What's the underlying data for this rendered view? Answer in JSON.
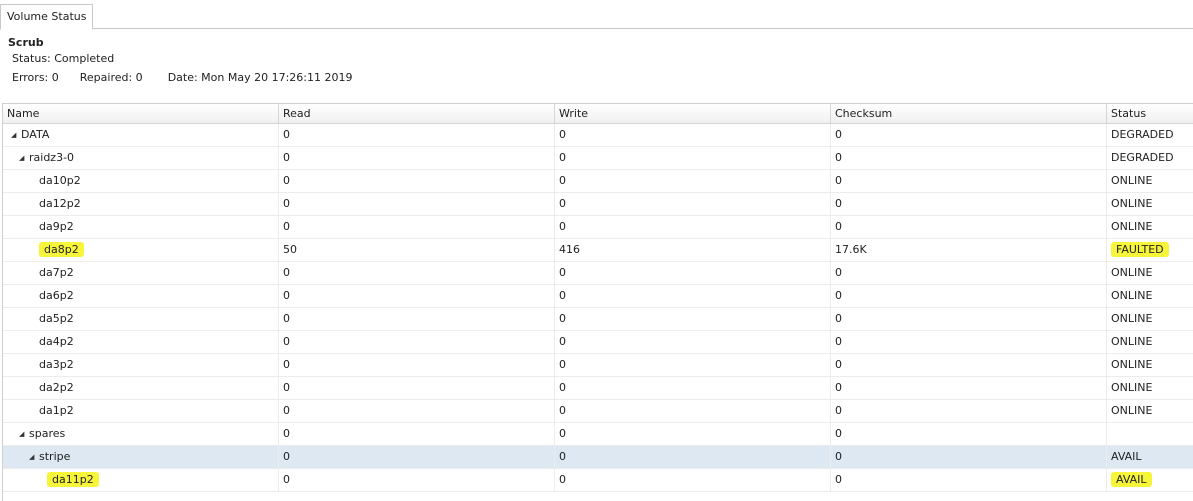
{
  "tab": {
    "label": "Volume Status"
  },
  "scrub": {
    "title": "Scrub",
    "status": "Status: Completed",
    "errors": "Errors: 0",
    "repaired": "Repaired: 0",
    "date": "Date: Mon May 20 17:26:11 2019"
  },
  "columns": [
    "Name",
    "Read",
    "Write",
    "Checksum",
    "Status"
  ],
  "rows": [
    {
      "name": "DATA",
      "read": "0",
      "write": "0",
      "checksum": "0",
      "status": "DEGRADED",
      "depth": 0,
      "expander": true
    },
    {
      "name": "raidz3-0",
      "read": "0",
      "write": "0",
      "checksum": "0",
      "status": "DEGRADED",
      "depth": 1,
      "expander": true
    },
    {
      "name": "da10p2",
      "read": "0",
      "write": "0",
      "checksum": "0",
      "status": "ONLINE",
      "depth": 2,
      "expander": false
    },
    {
      "name": "da12p2",
      "read": "0",
      "write": "0",
      "checksum": "0",
      "status": "ONLINE",
      "depth": 2,
      "expander": false
    },
    {
      "name": "da9p2",
      "read": "0",
      "write": "0",
      "checksum": "0",
      "status": "ONLINE",
      "depth": 2,
      "expander": false
    },
    {
      "name": "da8p2",
      "read": "50",
      "write": "416",
      "checksum": "17.6K",
      "status": "FAULTED",
      "depth": 2,
      "expander": false,
      "highlight": true
    },
    {
      "name": "da7p2",
      "read": "0",
      "write": "0",
      "checksum": "0",
      "status": "ONLINE",
      "depth": 2,
      "expander": false
    },
    {
      "name": "da6p2",
      "read": "0",
      "write": "0",
      "checksum": "0",
      "status": "ONLINE",
      "depth": 2,
      "expander": false
    },
    {
      "name": "da5p2",
      "read": "0",
      "write": "0",
      "checksum": "0",
      "status": "ONLINE",
      "depth": 2,
      "expander": false
    },
    {
      "name": "da4p2",
      "read": "0",
      "write": "0",
      "checksum": "0",
      "status": "ONLINE",
      "depth": 2,
      "expander": false
    },
    {
      "name": "da3p2",
      "read": "0",
      "write": "0",
      "checksum": "0",
      "status": "ONLINE",
      "depth": 2,
      "expander": false
    },
    {
      "name": "da2p2",
      "read": "0",
      "write": "0",
      "checksum": "0",
      "status": "ONLINE",
      "depth": 2,
      "expander": false
    },
    {
      "name": "da1p2",
      "read": "0",
      "write": "0",
      "checksum": "0",
      "status": "ONLINE",
      "depth": 2,
      "expander": false
    },
    {
      "name": "spares",
      "read": "0",
      "write": "0",
      "checksum": "0",
      "status": "",
      "depth": 1,
      "expander": true
    },
    {
      "name": "stripe",
      "read": "0",
      "write": "0",
      "checksum": "0",
      "status": "AVAIL",
      "depth": 2,
      "expander": true,
      "selected": true
    },
    {
      "name": "da11p2",
      "read": "0",
      "write": "0",
      "checksum": "0",
      "status": "AVAIL",
      "depth": 3,
      "expander": false,
      "highlight": true
    }
  ],
  "colors": {
    "highlight": "#f7f53a",
    "selected_row": "#dde8f3"
  }
}
